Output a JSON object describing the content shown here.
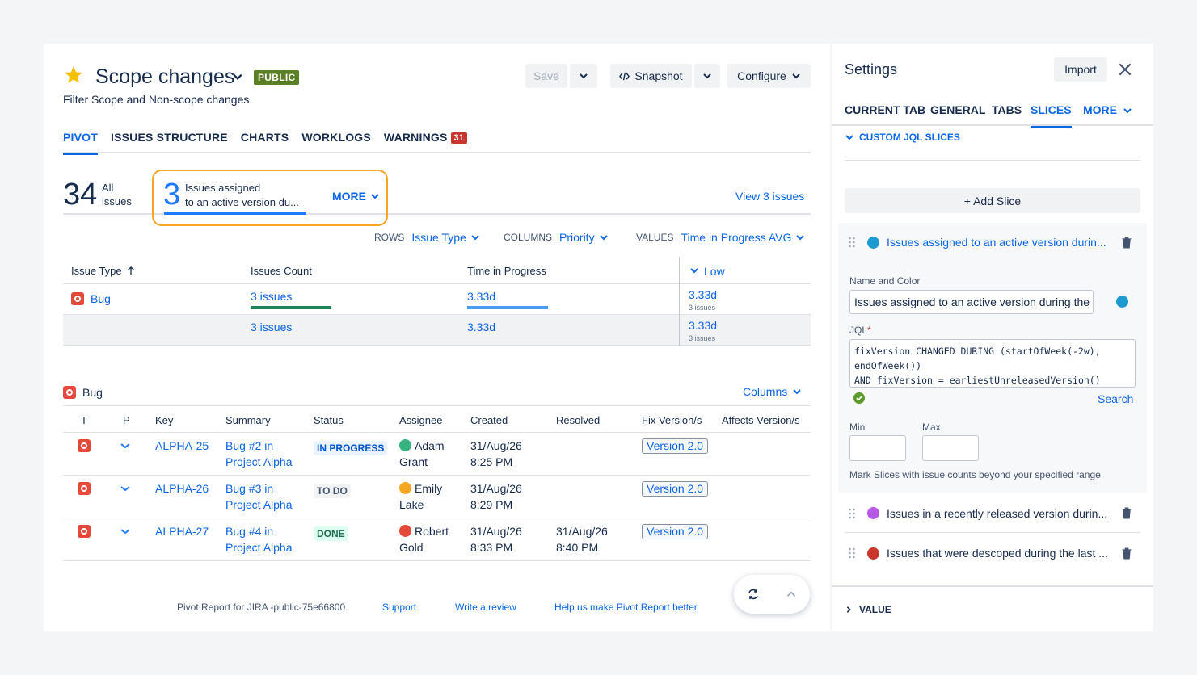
{
  "header": {
    "title": "Scope changes",
    "badge": "PUBLIC",
    "subtitle": "Filter Scope and Non-scope changes",
    "save_label": "Save",
    "snapshot_label": "Snapshot",
    "configure_label": "Configure"
  },
  "tabs": [
    {
      "label": "PIVOT",
      "active": true
    },
    {
      "label": "ISSUES STRUCTURE"
    },
    {
      "label": "CHARTS"
    },
    {
      "label": "WORKLOGS"
    },
    {
      "label": "WARNINGS",
      "badge": "31"
    }
  ],
  "summary": {
    "all_count": "34",
    "all_label_1": "All",
    "all_label_2": "issues",
    "slice_count": "3",
    "slice_label_1": "Issues assigned",
    "slice_label_2": "to an active version du...",
    "more_label": "MORE",
    "view_issues": "View 3 issues"
  },
  "config": {
    "rows_label": "ROWS",
    "rows_value": "Issue Type",
    "columns_label": "COLUMNS",
    "columns_value": "Priority",
    "values_label": "VALUES",
    "values_value": "Time in Progress AVG"
  },
  "pivot": {
    "headers": [
      "Issue Type",
      "Issues Count",
      "Time in Progress",
      "Low"
    ],
    "rows": [
      {
        "type": "Bug",
        "count": "3 issues",
        "time": "3.33d",
        "low": "3.33d",
        "low_sub": "3 issues",
        "count_fill": 1.0,
        "time_fill": 1.0
      },
      {
        "type": "",
        "count": "3 issues",
        "time": "3.33d",
        "low": "3.33d",
        "low_sub": "3 issues"
      }
    ]
  },
  "issues": {
    "group_label": "Bug",
    "columns_btn": "Columns",
    "headers": [
      "T",
      "P",
      "Key",
      "Summary",
      "Status",
      "Assignee",
      "Created",
      "Resolved",
      "Fix Version/s",
      "Affects Version/s"
    ],
    "rows": [
      {
        "key": "ALPHA-25",
        "summary_1": "Bug #2 in",
        "summary_2": "Project Alpha",
        "status": "IN PROGRESS",
        "status_kind": "prog",
        "assignee_1": "Adam",
        "assignee_2": "Grant",
        "avatar_color": "#36b37e",
        "created_1": "31/Aug/26",
        "created_2": "8:25 PM",
        "resolved_1": "",
        "resolved_2": "",
        "fix_version": "Version 2.0"
      },
      {
        "key": "ALPHA-26",
        "summary_1": "Bug #3 in",
        "summary_2": "Project Alpha",
        "status": "TO DO",
        "status_kind": "todo",
        "assignee_1": "Emily",
        "assignee_2": "Lake",
        "avatar_color": "#f5a623",
        "created_1": "31/Aug/26",
        "created_2": "8:29 PM",
        "resolved_1": "",
        "resolved_2": "",
        "fix_version": "Version 2.0"
      },
      {
        "key": "ALPHA-27",
        "summary_1": "Bug #4 in",
        "summary_2": "Project Alpha",
        "status": "DONE",
        "status_kind": "done",
        "assignee_1": "Robert",
        "assignee_2": "Gold",
        "avatar_color": "#e5493a",
        "created_1": "31/Aug/26",
        "created_2": "8:33 PM",
        "resolved_1": "31/Aug/26",
        "resolved_2": "8:40 PM",
        "fix_version": "Version 2.0"
      }
    ]
  },
  "footer": {
    "app": "Pivot Report for JIRA -public-75e66800",
    "support": "Support",
    "review": "Write a review",
    "help": "Help us make Pivot Report better"
  },
  "settings": {
    "title": "Settings",
    "import_label": "Import",
    "tabs": [
      "CURRENT TAB",
      "GENERAL",
      "TABS",
      "SLICES",
      "MORE"
    ],
    "section_label": "CUSTOM JQL SLICES",
    "add_slice": "+ Add Slice",
    "slices": [
      {
        "name": "Issues assigned to an active version durin...",
        "color": "#1d9bd1"
      },
      {
        "name": "Issues in a recently released version durin...",
        "color": "#b657e6"
      },
      {
        "name": "Issues that were descoped during the last ...",
        "color": "#c9372c"
      }
    ],
    "name_color_label": "Name and Color",
    "name_value": "Issues assigned to an active version during the last",
    "jql_label": "JQL",
    "jql_required": "*",
    "jql_value": "fixVersion CHANGED DURING (startOfWeek(-2w),\nendOfWeek())\nAND fixVersion = earliestUnreleasedVersion()",
    "search_label": "Search",
    "min_label": "Min",
    "max_label": "Max",
    "hint": "Mark Slices with issue counts beyond your specified range",
    "value_section": "VALUE"
  },
  "colors": {
    "accent": "#0c66e4",
    "highlight": "#f5a623",
    "count_bar": "#1f845a",
    "time_bar": "#4c9aff"
  }
}
